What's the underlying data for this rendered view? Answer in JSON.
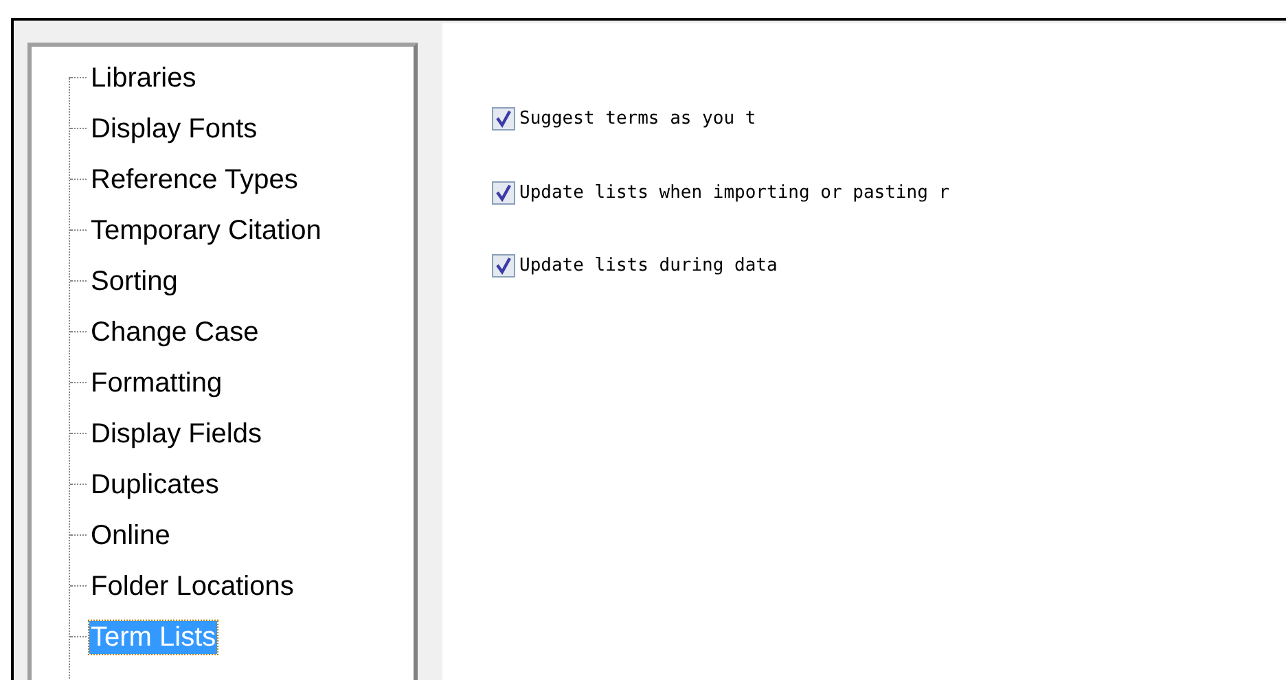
{
  "tree": {
    "items": [
      {
        "label": "Libraries",
        "selected": false
      },
      {
        "label": "Display Fonts",
        "selected": false
      },
      {
        "label": "Reference Types",
        "selected": false
      },
      {
        "label": "Temporary Citation",
        "selected": false
      },
      {
        "label": "Sorting",
        "selected": false
      },
      {
        "label": "Change Case",
        "selected": false
      },
      {
        "label": "Formatting",
        "selected": false
      },
      {
        "label": "Display Fields",
        "selected": false
      },
      {
        "label": "Duplicates",
        "selected": false
      },
      {
        "label": "Online",
        "selected": false
      },
      {
        "label": "Folder Locations",
        "selected": false
      },
      {
        "label": "Term Lists",
        "selected": true
      }
    ]
  },
  "options": [
    {
      "label": "Suggest terms as you t",
      "checked": true
    },
    {
      "label": "Update lists when importing or pasting r",
      "checked": true
    },
    {
      "label": "Update lists during data",
      "checked": true
    }
  ]
}
